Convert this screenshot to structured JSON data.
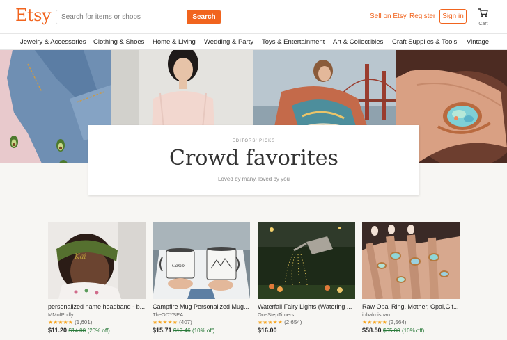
{
  "header": {
    "logo": "Etsy",
    "search_placeholder": "Search for items or shops",
    "search_button": "Search",
    "sell_link": "Sell on Etsy",
    "register_link": "Register",
    "signin_button": "Sign in",
    "cart_label": "Cart"
  },
  "nav": {
    "items": [
      "Jewelry & Accessories",
      "Clothing & Shoes",
      "Home & Living",
      "Wedding & Party",
      "Toys & Entertainment",
      "Art & Collectibles",
      "Craft Supplies & Tools",
      "Vintage"
    ]
  },
  "picks": {
    "eyebrow": "EDITORS' PICKS",
    "title": "Crowd favorites",
    "subtitle": "Loved by many, loved by you"
  },
  "products": [
    {
      "name": "personalized name headband - b...",
      "shop": "MMofPhilly",
      "stars": "★★★★★",
      "reviews": "(1,601)",
      "price": "$11.20",
      "original": "$14.00",
      "discount": "(20% off)"
    },
    {
      "name": "Campfire Mug Personalized Mug...",
      "shop": "TheODYSEA",
      "stars": "★★★★★",
      "reviews": "(407)",
      "price": "$15.71",
      "original": "$17.46",
      "discount": "(10% off)"
    },
    {
      "name": "Waterfall Fairy Lights (Watering ...",
      "shop": "OneStepTimers",
      "stars": "★★★★★",
      "reviews": "(2,654)",
      "price": "$16.00",
      "original": "",
      "discount": ""
    },
    {
      "name": "Raw Opal Ring, Mother, Opal,Gif...",
      "shop": "inbalmishan",
      "stars": "★★★★★",
      "reviews": "(2,564)",
      "price": "$58.50",
      "original": "$65.00",
      "discount": "(10% off)"
    }
  ],
  "colors": {
    "brand": "#F1641E",
    "star": "#f6a623",
    "sale": "#2a7a3a"
  }
}
